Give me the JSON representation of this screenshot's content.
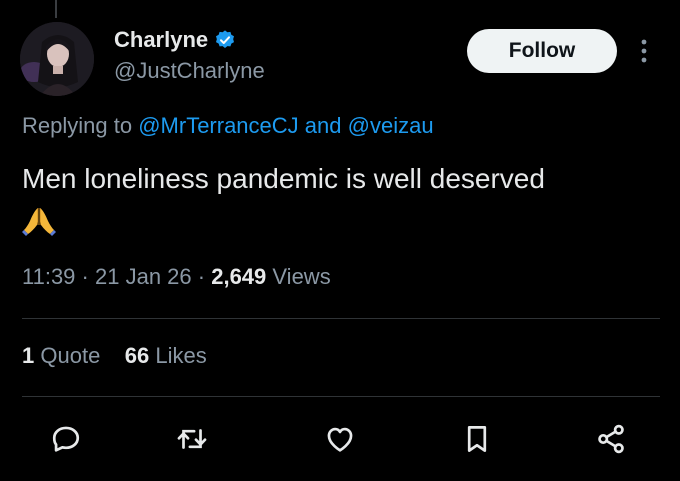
{
  "author": {
    "display_name": "Charlyne",
    "handle": "@JustCharlyne",
    "verified": true,
    "avatar": "profile-photo"
  },
  "follow_button": {
    "label": "Follow"
  },
  "more_menu": {
    "icon": "more-vertical-icon"
  },
  "reply": {
    "prefix": "Replying to",
    "mention_1": "@MrTerranceCJ",
    "joiner": "and",
    "mention_2": "@veizau"
  },
  "tweet": {
    "text": "Men loneliness pandemic is well deserved",
    "emoji": "🙏"
  },
  "meta": {
    "time": "11:39",
    "separator": "·",
    "date": "21 Jan 26",
    "views_count": "2,649",
    "views_label": "Views"
  },
  "stats": {
    "quotes_count": "1",
    "quotes_label": "Quote",
    "likes_count": "66",
    "likes_label": "Likes"
  },
  "actions": [
    "reply-icon",
    "retweet-icon",
    "like-icon",
    "bookmark-icon",
    "share-icon"
  ],
  "colors": {
    "background": "#000000",
    "text_primary": "#e7e9ea",
    "text_secondary": "#8b98a5",
    "link": "#1d9bf0",
    "verified": "#1d9bf0",
    "divider": "#2f3336",
    "follow_bg": "#eff3f4",
    "icon": "#e7e9ea"
  }
}
